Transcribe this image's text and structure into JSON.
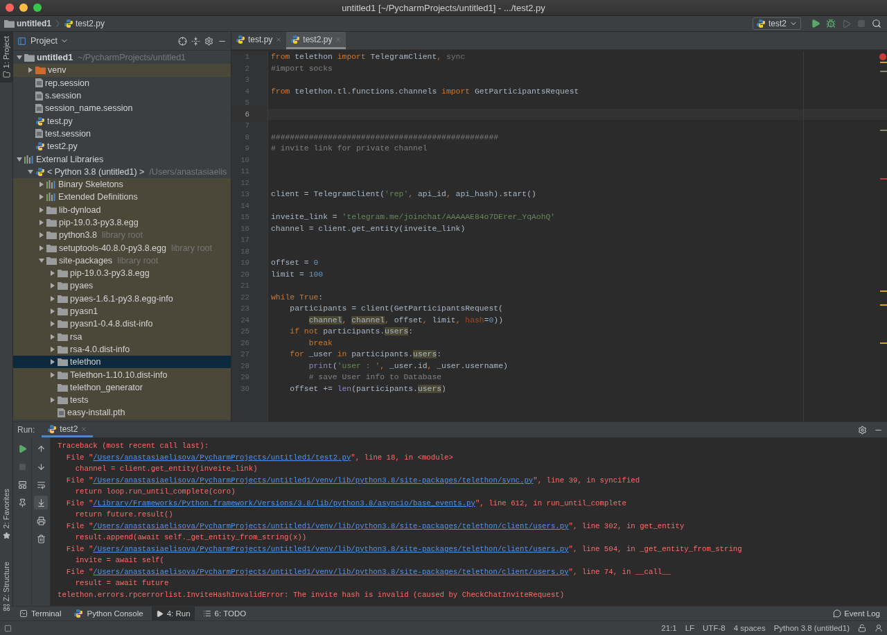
{
  "window": {
    "title": "untitled1 [~/PycharmProjects/untitled1] - .../test2.py"
  },
  "navbar": {
    "breadcrumbs": [
      {
        "kind": "folder",
        "label": "untitled1"
      },
      {
        "kind": "python",
        "label": "test2.py"
      }
    ],
    "run_config": "test2"
  },
  "left_strip": {
    "tabs": [
      {
        "kind": "project",
        "label": "1: Project",
        "selected": true
      },
      {
        "kind": "favorites",
        "label": "2: Favorites",
        "selected": false
      },
      {
        "kind": "structure",
        "label": "Z: Structure",
        "selected": false
      }
    ]
  },
  "project": {
    "title": "Project",
    "tree": [
      {
        "kind": "project",
        "label": "untitled1",
        "hint": "~/PycharmProjects/untitled1",
        "expanded": true,
        "shaded": false,
        "selected": false,
        "children": [
          {
            "kind": "venv",
            "label": "venv",
            "expanded": false,
            "shaded": true,
            "selected": false
          },
          {
            "kind": "file",
            "label": "rep.session",
            "shaded": false,
            "selected": false
          },
          {
            "kind": "file",
            "label": "s.session",
            "shaded": false,
            "selected": false
          },
          {
            "kind": "file",
            "label": "session_name.session",
            "shaded": false,
            "selected": false
          },
          {
            "kind": "python",
            "label": "test.py",
            "shaded": false,
            "selected": false
          },
          {
            "kind": "file",
            "label": "test.session",
            "shaded": false,
            "selected": false
          },
          {
            "kind": "python",
            "label": "test2.py",
            "shaded": false,
            "selected": false
          }
        ]
      },
      {
        "kind": "library",
        "label": "External Libraries",
        "expanded": true,
        "shaded": false,
        "selected": false,
        "children": [
          {
            "kind": "sdk",
            "label": "< Python 3.8 (untitled1) >",
            "hint": "/Users/anastasiaelis",
            "expanded": true,
            "shaded": false,
            "selected": false,
            "children": [
              {
                "kind": "library",
                "label": "Binary Skeletons",
                "expanded": false,
                "shaded": true,
                "selected": false
              },
              {
                "kind": "library",
                "label": "Extended Definitions",
                "expanded": false,
                "shaded": true,
                "selected": false
              },
              {
                "kind": "folder",
                "label": "lib-dynload",
                "expanded": false,
                "shaded": true,
                "selected": false
              },
              {
                "kind": "folder",
                "label": "pip-19.0.3-py3.8.egg",
                "expanded": false,
                "shaded": true,
                "selected": false
              },
              {
                "kind": "folder",
                "label": "python3.8",
                "hint": "library root",
                "expanded": false,
                "shaded": true,
                "selected": false
              },
              {
                "kind": "folder",
                "label": "setuptools-40.8.0-py3.8.egg",
                "hint": "library root",
                "expanded": false,
                "shaded": true,
                "selected": false
              },
              {
                "kind": "folder",
                "label": "site-packages",
                "hint": "library root",
                "expanded": true,
                "shaded": true,
                "selected": false,
                "children": [
                  {
                    "kind": "folder",
                    "label": "pip-19.0.3-py3.8.egg",
                    "expanded": false,
                    "shaded": true,
                    "selected": false
                  },
                  {
                    "kind": "folder",
                    "label": "pyaes",
                    "expanded": false,
                    "shaded": true,
                    "selected": false
                  },
                  {
                    "kind": "folder",
                    "label": "pyaes-1.6.1-py3.8.egg-info",
                    "expanded": false,
                    "shaded": true,
                    "selected": false
                  },
                  {
                    "kind": "folder",
                    "label": "pyasn1",
                    "expanded": false,
                    "shaded": true,
                    "selected": false
                  },
                  {
                    "kind": "folder",
                    "label": "pyasn1-0.4.8.dist-info",
                    "expanded": false,
                    "shaded": true,
                    "selected": false
                  },
                  {
                    "kind": "folder",
                    "label": "rsa",
                    "expanded": false,
                    "shaded": true,
                    "selected": false
                  },
                  {
                    "kind": "folder",
                    "label": "rsa-4.0.dist-info",
                    "expanded": false,
                    "shaded": true,
                    "selected": false
                  },
                  {
                    "kind": "folder",
                    "label": "telethon",
                    "expanded": false,
                    "shaded": true,
                    "selected": true
                  },
                  {
                    "kind": "folder",
                    "label": "Telethon-1.10.10.dist-info",
                    "expanded": false,
                    "shaded": true,
                    "selected": false
                  },
                  {
                    "kind": "folder",
                    "label": "telethon_generator",
                    "shaded": true,
                    "selected": false
                  },
                  {
                    "kind": "folder",
                    "label": "tests",
                    "expanded": false,
                    "shaded": true,
                    "selected": false
                  },
                  {
                    "kind": "file",
                    "label": "easy-install.pth",
                    "shaded": true,
                    "selected": false
                  }
                ]
              }
            ]
          }
        ]
      }
    ]
  },
  "editor": {
    "tabs": [
      {
        "label": "test.py",
        "selected": false
      },
      {
        "label": "test2.py",
        "selected": true
      }
    ],
    "lines": [
      {
        "number": "1",
        "current": false,
        "tokens": [
          {
            "kind": "kw",
            "text": "from "
          },
          {
            "kind": "plain",
            "text": "telethon "
          },
          {
            "kind": "kw",
            "text": "import "
          },
          {
            "kind": "plain",
            "text": "TelegramClient"
          },
          {
            "kind": "kw",
            "text": ", "
          },
          {
            "kind": "dim",
            "text": "sync"
          }
        ]
      },
      {
        "number": "2",
        "current": false,
        "tokens": [
          {
            "kind": "comment",
            "text": "#import socks"
          }
        ]
      },
      {
        "number": "3",
        "current": false
      },
      {
        "number": "4",
        "current": false,
        "tokens": [
          {
            "kind": "kw",
            "text": "from "
          },
          {
            "kind": "plain",
            "text": "telethon.tl.functions.channels "
          },
          {
            "kind": "kw",
            "text": "import "
          },
          {
            "kind": "plain",
            "text": "GetParticipantsRequest"
          }
        ]
      },
      {
        "number": "5",
        "current": false
      },
      {
        "number": "6",
        "current": true
      },
      {
        "number": "7",
        "current": false
      },
      {
        "number": "8",
        "current": false,
        "tokens": [
          {
            "kind": "comment",
            "text": "################################################"
          }
        ]
      },
      {
        "number": "9",
        "current": false,
        "tokens": [
          {
            "kind": "comment",
            "text": "# invite link for private channel"
          }
        ]
      },
      {
        "number": "10",
        "current": false
      },
      {
        "number": "11",
        "current": false
      },
      {
        "number": "12",
        "current": false
      },
      {
        "number": "13",
        "current": false,
        "tokens": [
          {
            "kind": "plain",
            "text": "client = TelegramClient("
          },
          {
            "kind": "str",
            "text": "'rep'"
          },
          {
            "kind": "kw",
            "text": ", "
          },
          {
            "kind": "plain",
            "text": "api_id"
          },
          {
            "kind": "kw",
            "text": ", "
          },
          {
            "kind": "plain",
            "text": "api_hash).start()"
          }
        ]
      },
      {
        "number": "14",
        "current": false
      },
      {
        "number": "15",
        "current": false,
        "tokens": [
          {
            "kind": "plain",
            "text": "inveite_link = "
          },
          {
            "kind": "str",
            "text": "'telegram.me/joinchat/AAAAAE84o7DErer_YqAohQ'"
          }
        ]
      },
      {
        "number": "16",
        "current": false,
        "tokens": [
          {
            "kind": "plain",
            "text": "channel = client.get_entity(inveite_link)"
          }
        ]
      },
      {
        "number": "17",
        "current": false
      },
      {
        "number": "18",
        "current": false
      },
      {
        "number": "19",
        "current": false,
        "tokens": [
          {
            "kind": "plain",
            "text": "offset = "
          },
          {
            "kind": "num",
            "text": "0"
          }
        ]
      },
      {
        "number": "20",
        "current": false,
        "tokens": [
          {
            "kind": "plain",
            "text": "limit = "
          },
          {
            "kind": "num",
            "text": "100"
          }
        ]
      },
      {
        "number": "21",
        "current": false
      },
      {
        "number": "22",
        "current": false,
        "tokens": [
          {
            "kind": "kw",
            "text": "while True"
          },
          {
            "kind": "plain",
            "text": ":"
          }
        ]
      },
      {
        "number": "23",
        "current": false,
        "tokens": [
          {
            "kind": "plain",
            "text": "    participants = client(GetParticipantsRequest("
          }
        ]
      },
      {
        "number": "24",
        "current": false,
        "tokens": [
          {
            "kind": "hl",
            "text": "        channel"
          },
          {
            "kind": "kw",
            "text": ", "
          },
          {
            "kind": "hl",
            "text": "channel"
          },
          {
            "kind": "kw",
            "text": ", "
          },
          {
            "kind": "plain",
            "text": "offset"
          },
          {
            "kind": "kw",
            "text": ", "
          },
          {
            "kind": "plain",
            "text": "limit"
          },
          {
            "kind": "kw",
            "text": ", "
          },
          {
            "kind": "param",
            "text": "hash"
          },
          {
            "kind": "plain",
            "text": "="
          },
          {
            "kind": "num",
            "text": "0"
          },
          {
            "kind": "plain",
            "text": "))"
          }
        ]
      },
      {
        "number": "25",
        "current": false,
        "tokens": [
          {
            "kind": "kw",
            "text": "    if not "
          },
          {
            "kind": "plain",
            "text": "participants."
          },
          {
            "kind": "hl",
            "text": "users"
          },
          {
            "kind": "plain",
            "text": ":"
          }
        ]
      },
      {
        "number": "26",
        "current": false,
        "tokens": [
          {
            "kind": "kw",
            "text": "        break"
          }
        ]
      },
      {
        "number": "27",
        "current": false,
        "tokens": [
          {
            "kind": "kw",
            "text": "    for "
          },
          {
            "kind": "plain",
            "text": "_user "
          },
          {
            "kind": "kw",
            "text": "in "
          },
          {
            "kind": "plain",
            "text": "participants."
          },
          {
            "kind": "hl",
            "text": "users"
          },
          {
            "kind": "plain",
            "text": ":"
          }
        ]
      },
      {
        "number": "28",
        "current": false,
        "tokens": [
          {
            "kind": "builtin",
            "text": "        print"
          },
          {
            "kind": "plain",
            "text": "("
          },
          {
            "kind": "str",
            "text": "'user : '"
          },
          {
            "kind": "kw",
            "text": ", "
          },
          {
            "kind": "plain",
            "text": "_user.id"
          },
          {
            "kind": "kw",
            "text": ", "
          },
          {
            "kind": "plain",
            "text": "_user.username)"
          }
        ]
      },
      {
        "number": "29",
        "current": false,
        "tokens": [
          {
            "kind": "comment",
            "text": "        # save User info to Database"
          }
        ]
      },
      {
        "number": "30",
        "current": false,
        "tokens": [
          {
            "kind": "plain",
            "text": "    offset += "
          },
          {
            "kind": "builtin",
            "text": "len"
          },
          {
            "kind": "plain",
            "text": "(participants."
          },
          {
            "kind": "hl",
            "text": "users"
          },
          {
            "kind": "plain",
            "text": ")"
          }
        ]
      }
    ]
  },
  "run": {
    "label": "Run:",
    "tab": "test2",
    "console": [
      {
        "kind": "text",
        "text": "Traceback (most recent call last):"
      },
      {
        "kind": "file",
        "head": "  File \"",
        "path": "/Users/anastasiaelisova/PycharmProjects/untitled1/test2.py",
        "tail": "\", line 18, in <module>"
      },
      {
        "kind": "text",
        "text": "    channel = client.get_entity(inveite_link)"
      },
      {
        "kind": "file",
        "head": "  File \"",
        "path": "/Users/anastasiaelisova/PycharmProjects/untitled1/venv/lib/python3.8/site-packages/telethon/sync.py",
        "tail": "\", line 39, in syncified"
      },
      {
        "kind": "text",
        "text": "    return loop.run_until_complete(coro)"
      },
      {
        "kind": "file",
        "head": "  File \"",
        "path": "/Library/Frameworks/Python.framework/Versions/3.8/lib/python3.8/asyncio/base_events.py",
        "tail": "\", line 612, in run_until_complete"
      },
      {
        "kind": "text",
        "text": "    return future.result()"
      },
      {
        "kind": "file",
        "head": "  File \"",
        "path": "/Users/anastasiaelisova/PycharmProjects/untitled1/venv/lib/python3.8/site-packages/telethon/client/users.py",
        "tail": "\", line 302, in get_entity"
      },
      {
        "kind": "text",
        "text": "    result.append(await self._get_entity_from_string(x))"
      },
      {
        "kind": "file",
        "head": "  File \"",
        "path": "/Users/anastasiaelisova/PycharmProjects/untitled1/venv/lib/python3.8/site-packages/telethon/client/users.py",
        "tail": "\", line 504, in _get_entity_from_string"
      },
      {
        "kind": "text",
        "text": "    invite = await self("
      },
      {
        "kind": "file",
        "head": "  File \"",
        "path": "/Users/anastasiaelisova/PycharmProjects/untitled1/venv/lib/python3.8/site-packages/telethon/client/users.py",
        "tail": "\", line 74, in __call__"
      },
      {
        "kind": "text",
        "text": "    result = await future"
      },
      {
        "kind": "text",
        "text": "telethon.errors.rpcerrorlist.InviteHashInvalidError: The invite hash is invalid (caused by CheckChatInviteRequest)"
      }
    ]
  },
  "bottom_tabs": [
    {
      "kind": "terminal",
      "label": "Terminal",
      "selected": false
    },
    {
      "kind": "console",
      "label": "Python Console",
      "selected": false
    },
    {
      "kind": "run",
      "label": "4: Run",
      "selected": true
    },
    {
      "kind": "todo",
      "label": "6: TODO",
      "selected": false
    }
  ],
  "event_log": "Event Log",
  "status_bar": [
    "21:1",
    "LF",
    "UTF-8",
    "4 spaces",
    "Python 3.8 (untitled1)"
  ]
}
